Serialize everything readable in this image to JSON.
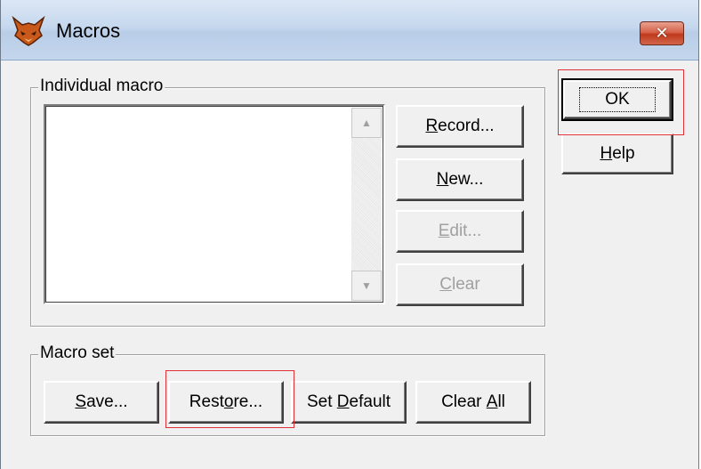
{
  "window": {
    "title": "Macros",
    "icon": "fox-icon"
  },
  "individual_macro": {
    "label": "Individual macro",
    "buttons": {
      "record": {
        "pre": "",
        "key": "R",
        "post": "ecord..."
      },
      "new": {
        "pre": "",
        "key": "N",
        "post": "ew..."
      },
      "edit": {
        "pre": "",
        "key": "E",
        "post": "dit..."
      },
      "clear": {
        "pre": "",
        "key": "C",
        "post": "lear"
      }
    }
  },
  "macro_set": {
    "label": "Macro set",
    "buttons": {
      "save": {
        "pre": "",
        "key": "S",
        "post": "ave..."
      },
      "restore": {
        "pre": "Rest",
        "key": "o",
        "post": "re..."
      },
      "set_default": {
        "pre": "Set ",
        "key": "D",
        "post": "efault"
      },
      "clear_all": {
        "pre": "Clear ",
        "key": "A",
        "post": "ll"
      }
    }
  },
  "side_buttons": {
    "ok": "OK",
    "help": {
      "pre": "",
      "key": "H",
      "post": "elp"
    }
  },
  "colors": {
    "highlight": "#e0303a",
    "disabled_text": "#a0a0a0"
  }
}
